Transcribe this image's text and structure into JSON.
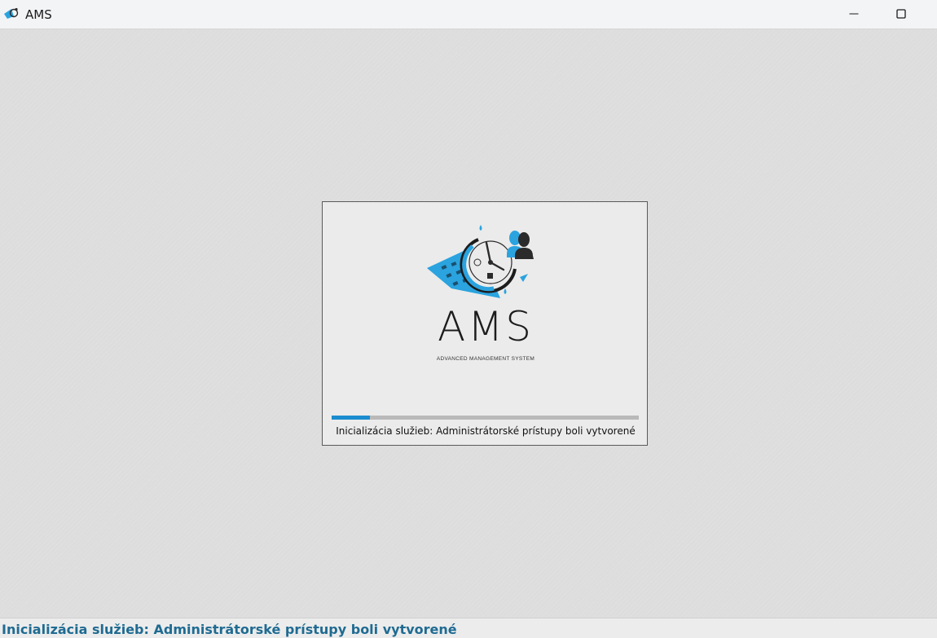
{
  "window": {
    "title": "AMS",
    "app_icon": "ams-logo-icon",
    "controls": [
      "minimize-icon",
      "maximize-icon"
    ]
  },
  "splash": {
    "brand_name": "AMS",
    "brand_subtitle": "ADVANCED MANAGEMENT SYSTEM",
    "progress_percent": 12.5,
    "status_text": "Inicializácia služieb: Administrátorské prístupy boli vytvorené"
  },
  "statusbar": {
    "text": "Inicializácia služieb: Administrátorské prístupy boli vytvorené"
  },
  "colors": {
    "accent": "#1b8ccf",
    "status_text": "#1f6b92",
    "logo_blue": "#2aa3df",
    "logo_dark": "#2b2b2b"
  }
}
